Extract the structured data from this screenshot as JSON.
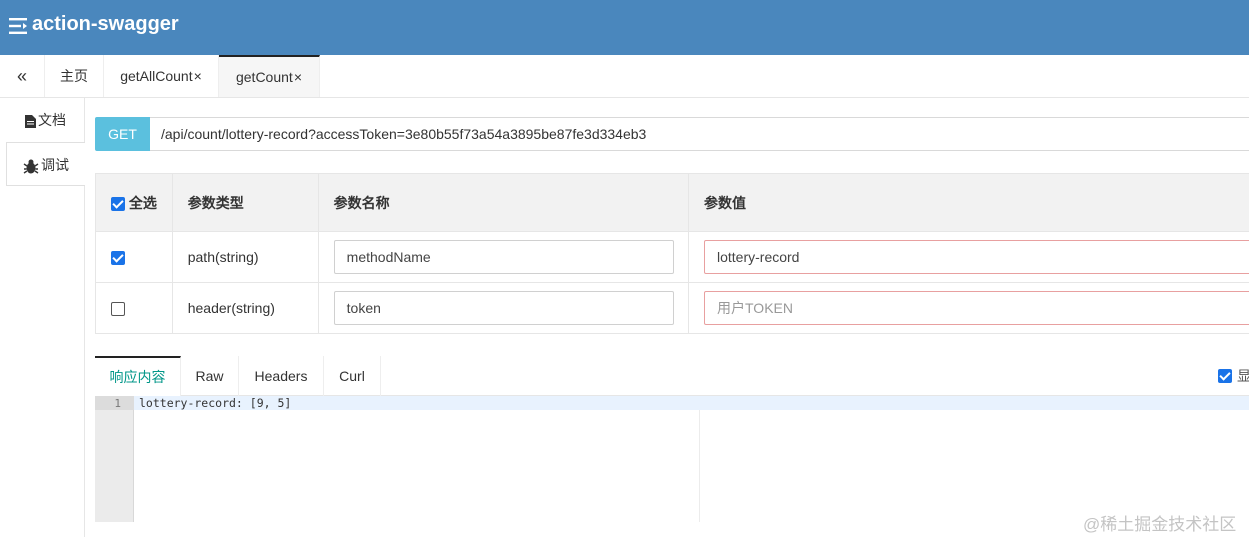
{
  "header": {
    "title": "action-swagger",
    "menu_icon": "menu-icon",
    "bg_color": "#4a87bd"
  },
  "tabs": {
    "collapse_glyph": "«",
    "items": [
      {
        "label": "主页",
        "closable": false
      },
      {
        "label": "getAllCount",
        "closable": true
      },
      {
        "label": "getCount",
        "closable": true,
        "active": true
      }
    ],
    "close_glyph": "×"
  },
  "sidenav": {
    "items": [
      {
        "label": "文档",
        "icon": "file-icon"
      },
      {
        "label": "调试",
        "icon": "bug-icon",
        "active": true
      }
    ]
  },
  "request": {
    "method": "GET",
    "url": "/api/count/lottery-record?accessToken=3e80b55f73a54a3895be87fe3d334eb3",
    "method_color": "#5bc0de"
  },
  "params": {
    "headers": {
      "select_all": "全选",
      "type": "参数类型",
      "name": "参数名称",
      "value": "参数值"
    },
    "select_all_checked": true,
    "rows": [
      {
        "checked": true,
        "type": "path(string)",
        "name": "methodName",
        "value": "lottery-record",
        "placeholder": ""
      },
      {
        "checked": false,
        "type": "header(string)",
        "name": "token",
        "value": "",
        "placeholder": "用户TOKEN"
      }
    ]
  },
  "response": {
    "tabs": [
      "响应内容",
      "Raw",
      "Headers",
      "Curl"
    ],
    "active_tab": "响应内容",
    "show_label": "显",
    "show_checked": true,
    "lines": [
      {
        "no": "1",
        "text": "lottery-record: [9, 5]"
      }
    ]
  },
  "watermark": "@稀土掘金技术社区"
}
